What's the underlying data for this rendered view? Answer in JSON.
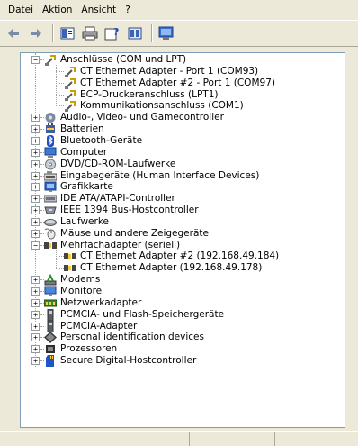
{
  "menu": {
    "items": [
      "Datei",
      "Aktion",
      "Ansicht",
      "?"
    ]
  },
  "toolbar": {
    "buttons": [
      "back-icon",
      "forward-icon",
      "properties-icon",
      "print-icon",
      "help-icon",
      "view-icon",
      "scan-hardware-icon"
    ]
  },
  "tree": {
    "items": [
      {
        "label": "Anschlüsse (COM und LPT)",
        "icon": "port-icon",
        "expanded": true
      },
      {
        "label": "CT Ethernet Adapter - Port 1 (COM93)",
        "icon": "port-icon"
      },
      {
        "label": "CT Ethernet Adapter #2 - Port 1 (COM97)",
        "icon": "port-icon"
      },
      {
        "label": "ECP-Druckeranschluss (LPT1)",
        "icon": "port-icon"
      },
      {
        "label": "Kommunikationsanschluss (COM1)",
        "icon": "port-icon"
      },
      {
        "label": "Audio-, Video- und Gamecontroller",
        "icon": "audio-icon"
      },
      {
        "label": "Batterien",
        "icon": "battery-icon"
      },
      {
        "label": "Bluetooth-Geräte",
        "icon": "bluetooth-icon"
      },
      {
        "label": "Computer",
        "icon": "computer-icon"
      },
      {
        "label": "DVD/CD-ROM-Laufwerke",
        "icon": "dvd-icon"
      },
      {
        "label": "Eingabegeräte (Human Interface Devices)",
        "icon": "keyboard-icon"
      },
      {
        "label": "Grafikkarte",
        "icon": "display-adapter-icon"
      },
      {
        "label": "IDE ATA/ATAPI-Controller",
        "icon": "ide-icon"
      },
      {
        "label": "IEEE 1394 Bus-Hostcontroller",
        "icon": "firewire-icon"
      },
      {
        "label": "Laufwerke",
        "icon": "disk-drive-icon"
      },
      {
        "label": "Mäuse und andere Zeigegeräte",
        "icon": "mouse-icon"
      },
      {
        "label": "Mehrfachadapter (seriell)",
        "icon": "multiport-icon",
        "expanded": true
      },
      {
        "label": "CT Ethernet Adapter #2 (192.168.49.184)",
        "icon": "multiport-icon"
      },
      {
        "label": "CT Ethernet Adapter (192.168.49.178)",
        "icon": "multiport-icon"
      },
      {
        "label": "Modems",
        "icon": "modem-icon"
      },
      {
        "label": "Monitore",
        "icon": "monitor-icon"
      },
      {
        "label": "Netzwerkadapter",
        "icon": "network-adapter-icon"
      },
      {
        "label": "PCMCIA- und Flash-Speichergeräte",
        "icon": "pcmcia-icon"
      },
      {
        "label": "PCMCIA-Adapter",
        "icon": "pcmcia-icon"
      },
      {
        "label": "Personal identification devices",
        "icon": "diamond-icon"
      },
      {
        "label": "Prozessoren",
        "icon": "processor-icon"
      },
      {
        "label": "Secure Digital-Hostcontroller",
        "icon": "sd-icon"
      }
    ]
  },
  "colors": {
    "chrome": "#ece9d8",
    "tree_bg": "#ffffff",
    "border": "#7f9db9"
  }
}
